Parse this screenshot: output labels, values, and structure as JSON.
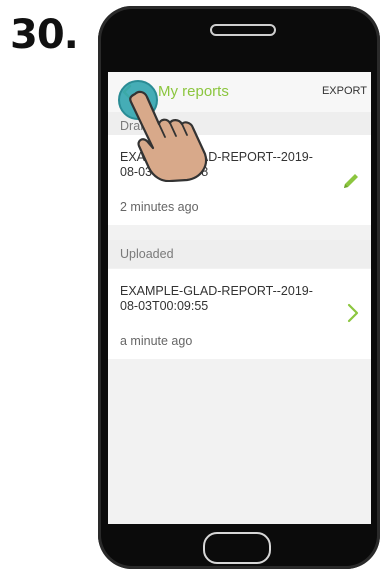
{
  "step": {
    "number": "30."
  },
  "app": {
    "title": "My reports",
    "export_label": "EXPORT"
  },
  "sections": {
    "drafts": {
      "label": "Drafts",
      "report": {
        "name": "EXAMPLE-GLAD-REPORT--2019-08-03T00:09:08",
        "time": "2 minutes ago"
      }
    },
    "uploaded": {
      "label": "Uploaded",
      "report": {
        "name": "EXAMPLE-GLAD-REPORT--2019-08-03T00:09:55",
        "time": "a minute ago"
      }
    }
  },
  "icons": {
    "back": "arrow-left-icon",
    "edit": "pencil-icon",
    "open": "chevron-right-icon",
    "pointer": "pointing-hand-icon"
  },
  "colors": {
    "accent": "#8cc63f",
    "touch_indicator": "#35a6b0",
    "hand_skin": "#d8a98a"
  }
}
